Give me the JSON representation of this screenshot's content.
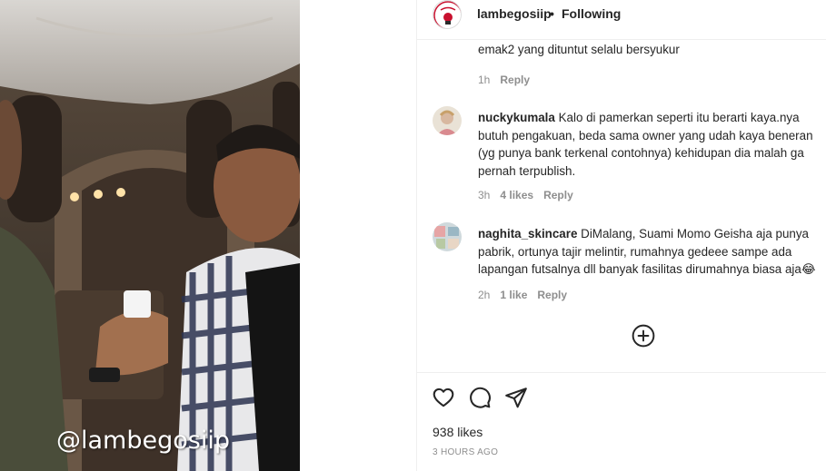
{
  "media": {
    "watermark": "@lambegosiip"
  },
  "header": {
    "username": "lambegosiip",
    "separator": "•",
    "follow_state": "Following"
  },
  "comments": [
    {
      "username": "",
      "text": "emak2 yang dituntut selalu bersyukur",
      "time": "1h",
      "likes": "",
      "reply": "Reply"
    },
    {
      "username": "nuckykumala",
      "text": "Kalo di pamerkan seperti itu berarti kaya.nya butuh pengakuan, beda sama owner yang udah kaya beneran (yg punya bank terkenal contohnya) kehidupan dia malah ga pernah terpublish.",
      "time": "3h",
      "likes": "4 likes",
      "reply": "Reply"
    },
    {
      "username": "naghita_skincare",
      "text": "DiMalang, Suami Momo Geisha aja punya pabrik, ortunya tajir melintir, rumahnya gedeee sampe ada lapangan futsalnya dll banyak fasilitas dirumahnya biasa aja😂",
      "time": "2h",
      "likes": "1 like",
      "reply": "Reply"
    }
  ],
  "load_more_icon": "plus-circle-icon",
  "actions": {
    "icons": [
      "heart-icon",
      "comment-icon",
      "share-icon"
    ],
    "likes_count": "938 likes",
    "posted": "3 HOURS AGO"
  }
}
